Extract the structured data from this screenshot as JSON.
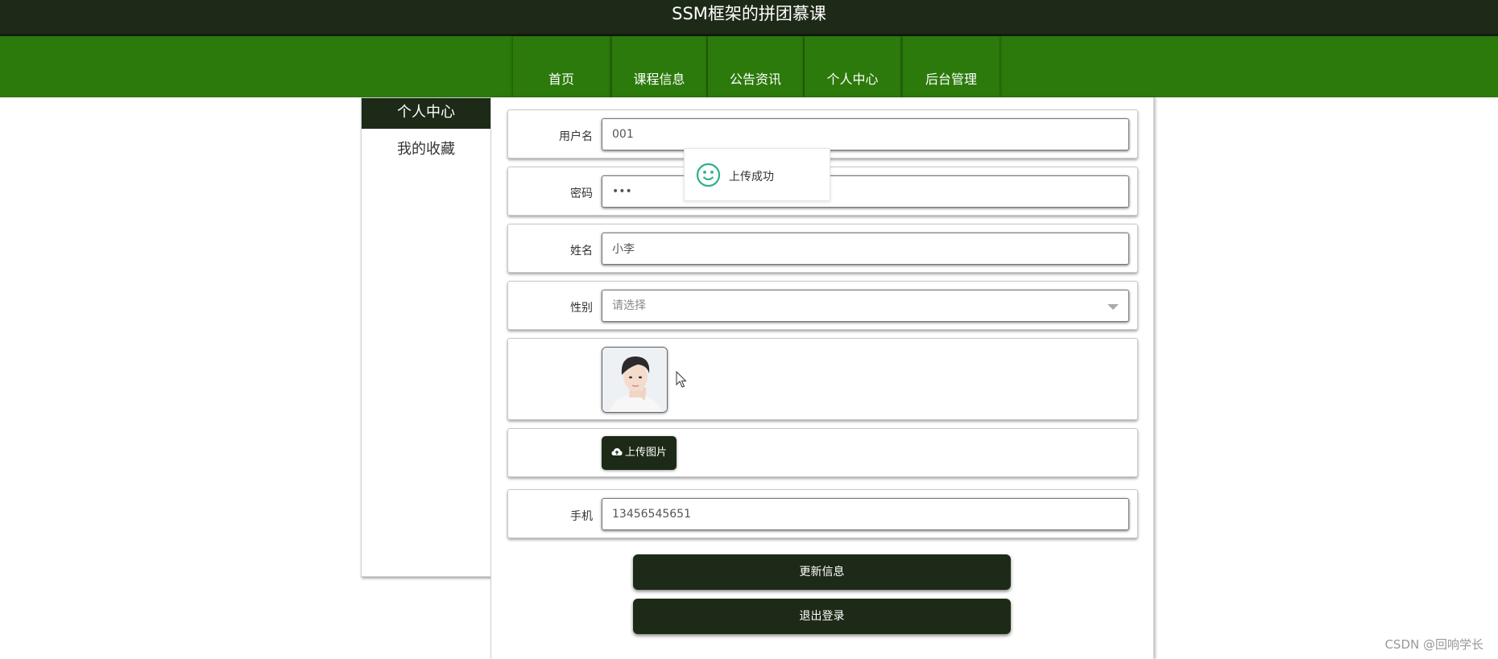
{
  "site_title": "SSM框架的拼团慕课",
  "nav": {
    "items": [
      {
        "label": "首页"
      },
      {
        "label": "课程信息"
      },
      {
        "label": "公告资讯"
      },
      {
        "label": "个人中心"
      },
      {
        "label": "后台管理"
      }
    ]
  },
  "sidebar": {
    "items": [
      {
        "label": "个人中心",
        "active": true
      },
      {
        "label": "我的收藏",
        "active": false
      }
    ]
  },
  "form": {
    "username": {
      "label": "用户名",
      "value": "001"
    },
    "password": {
      "label": "密码",
      "value": "•••"
    },
    "name": {
      "label": "姓名",
      "value": "小李"
    },
    "gender": {
      "label": "性别",
      "placeholder": "请选择"
    },
    "upload_label": "上传图片",
    "phone": {
      "label": "手机",
      "value": "13456545651"
    },
    "update_label": "更新信息",
    "logout_label": "退出登录"
  },
  "toast": {
    "message": "上传成功",
    "icon": "smiley-icon",
    "color": "#2db08c"
  },
  "watermark": "CSDN @回响学长",
  "colors": {
    "header": "#1e2a18",
    "nav": "#2b7a0b",
    "button": "#1d2a17"
  }
}
